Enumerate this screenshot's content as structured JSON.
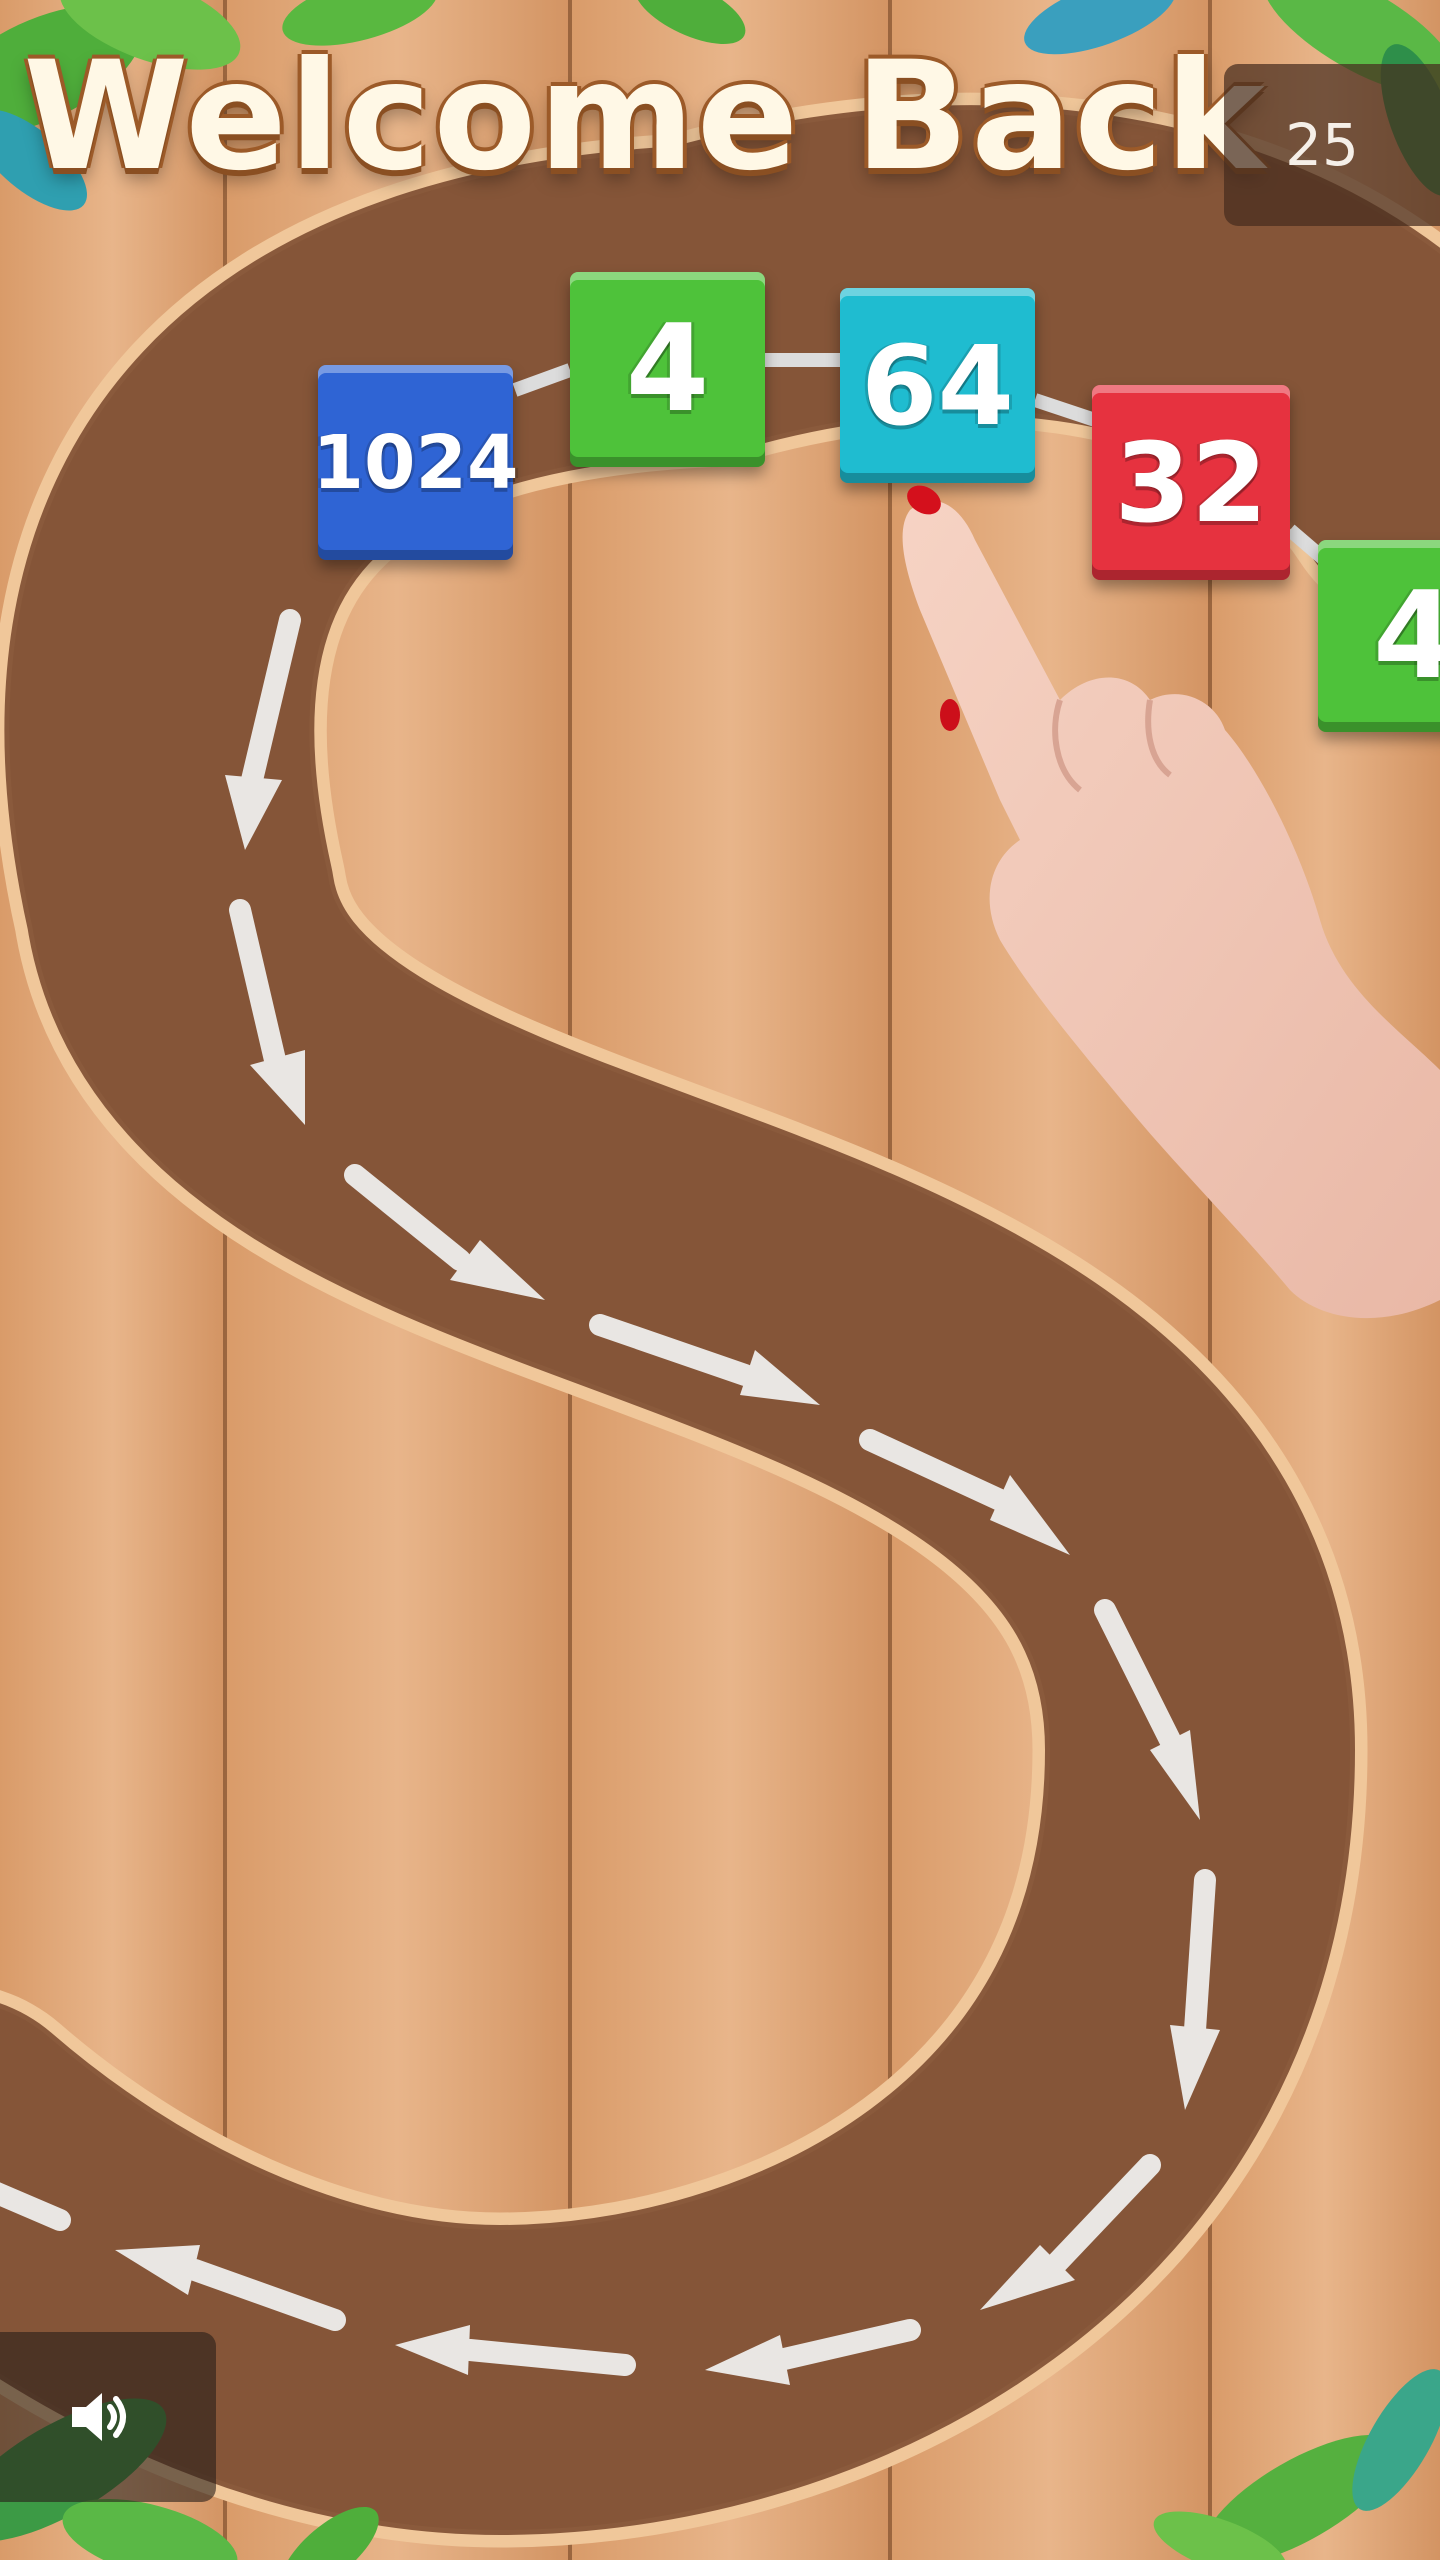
{
  "title": "Welcome Back",
  "timer": {
    "value": "25"
  },
  "tiles": [
    {
      "value": "1024",
      "color": "#2f64d4"
    },
    {
      "value": "4",
      "color": "#4ec23a"
    },
    {
      "value": "64",
      "color": "#1fbcd0"
    },
    {
      "value": "32",
      "color": "#e6323f"
    },
    {
      "value": "4",
      "color": "#4ec23a"
    }
  ],
  "sound": {
    "icon": "speaker-icon"
  },
  "colors": {
    "track": "#8a5a3c",
    "wood": "#d9a274",
    "arrow": "#e9e6e3"
  }
}
